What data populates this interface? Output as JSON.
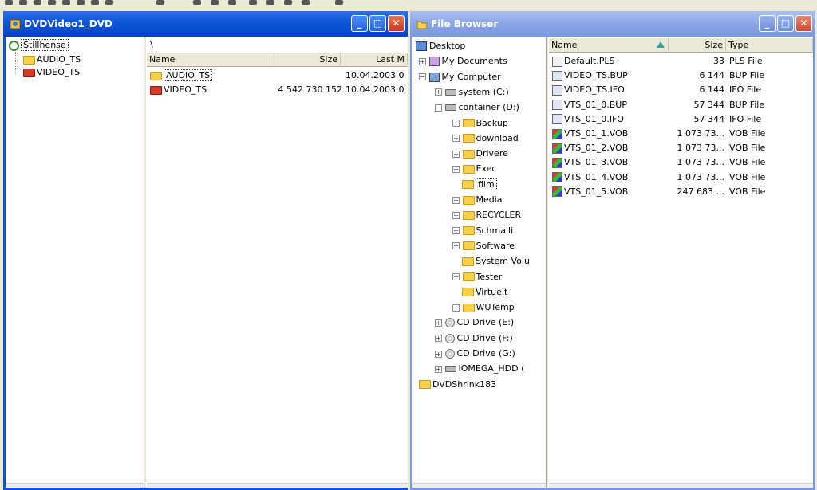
{
  "left_window": {
    "title": "DVDVideo1_DVD",
    "tree": [
      {
        "label": "Stillhense",
        "icon": "disc-icon"
      },
      {
        "label": "AUDIO_TS",
        "icon": "folder-icon"
      },
      {
        "label": "VIDEO_TS",
        "icon": "video-folder-icon"
      }
    ],
    "path": "\\",
    "columns": [
      "Name",
      "Size",
      "Last M"
    ],
    "files": [
      {
        "name": "AUDIO_TS",
        "size": "",
        "date": "10.04.2003 0",
        "icon": "folder-icon"
      },
      {
        "name": "VIDEO_TS",
        "size": "4 542 730 152",
        "date": "10.04.2003 0",
        "icon": "video-folder-icon"
      }
    ]
  },
  "right_window": {
    "title": "File Browser",
    "tree": [
      {
        "label": "Desktop",
        "icon": "desktop-icon",
        "level": 0,
        "exp": ""
      },
      {
        "label": "My Documents",
        "icon": "documents-icon",
        "level": 1,
        "exp": "+"
      },
      {
        "label": "My Computer",
        "icon": "computer-icon",
        "level": 1,
        "exp": "−"
      },
      {
        "label": "system (C:)",
        "icon": "drive-icon",
        "level": 2,
        "exp": "+"
      },
      {
        "label": "container (D:)",
        "icon": "drive-icon",
        "level": 2,
        "exp": "−"
      },
      {
        "label": "Backup",
        "icon": "folder-icon",
        "level": 3,
        "exp": "+"
      },
      {
        "label": "download",
        "icon": "folder-icon",
        "level": 3,
        "exp": "+"
      },
      {
        "label": "Drivere",
        "icon": "folder-icon",
        "level": 3,
        "exp": "+"
      },
      {
        "label": "Exec",
        "icon": "folder-icon",
        "level": 3,
        "exp": "+"
      },
      {
        "label": "film",
        "icon": "folder-icon",
        "level": 3,
        "exp": ""
      },
      {
        "label": "Media",
        "icon": "folder-icon",
        "level": 3,
        "exp": "+"
      },
      {
        "label": "RECYCLER",
        "icon": "folder-icon",
        "level": 3,
        "exp": "+"
      },
      {
        "label": "Schmalli",
        "icon": "folder-icon",
        "level": 3,
        "exp": "+"
      },
      {
        "label": "Software",
        "icon": "folder-icon",
        "level": 3,
        "exp": "+"
      },
      {
        "label": "System Volu",
        "icon": "folder-icon",
        "level": 3,
        "exp": ""
      },
      {
        "label": "Tester",
        "icon": "folder-icon",
        "level": 3,
        "exp": "+"
      },
      {
        "label": "Virtuelt",
        "icon": "folder-icon",
        "level": 3,
        "exp": ""
      },
      {
        "label": "WUTemp",
        "icon": "folder-icon",
        "level": 3,
        "exp": "+"
      },
      {
        "label": "CD Drive (E:)",
        "icon": "cd-drive-icon",
        "level": 2,
        "exp": "+"
      },
      {
        "label": "CD Drive (F:)",
        "icon": "cd-drive-icon",
        "level": 2,
        "exp": "+"
      },
      {
        "label": "CD Drive (G:)",
        "icon": "cd-drive-icon",
        "level": 2,
        "exp": "+"
      },
      {
        "label": "IOMEGA_HDD (",
        "icon": "drive-icon",
        "level": 2,
        "exp": "+"
      },
      {
        "label": "DVDShrink183",
        "icon": "folder-icon",
        "level": 1,
        "exp": ""
      }
    ],
    "columns": [
      "Name",
      "Size",
      "Type"
    ],
    "files": [
      {
        "name": "Default.PLS",
        "size": "33",
        "type": "PLS File"
      },
      {
        "name": "VIDEO_TS.BUP",
        "size": "6 144",
        "type": "BUP File"
      },
      {
        "name": "VIDEO_TS.IFO",
        "size": "6 144",
        "type": "IFO File"
      },
      {
        "name": "VTS_01_0.BUP",
        "size": "57 344",
        "type": "BUP File"
      },
      {
        "name": "VTS_01_0.IFO",
        "size": "57 344",
        "type": "IFO File"
      },
      {
        "name": "VTS_01_1.VOB",
        "size": "1 073 73...",
        "type": "VOB File"
      },
      {
        "name": "VTS_01_2.VOB",
        "size": "1 073 73...",
        "type": "VOB File"
      },
      {
        "name": "VTS_01_3.VOB",
        "size": "1 073 73...",
        "type": "VOB File"
      },
      {
        "name": "VTS_01_4.VOB",
        "size": "1 073 73...",
        "type": "VOB File"
      },
      {
        "name": "VTS_01_5.VOB",
        "size": "247 683 ...",
        "type": "VOB File"
      }
    ]
  },
  "window_buttons": {
    "minimize": "_",
    "maximize": "□",
    "close": "✕"
  }
}
